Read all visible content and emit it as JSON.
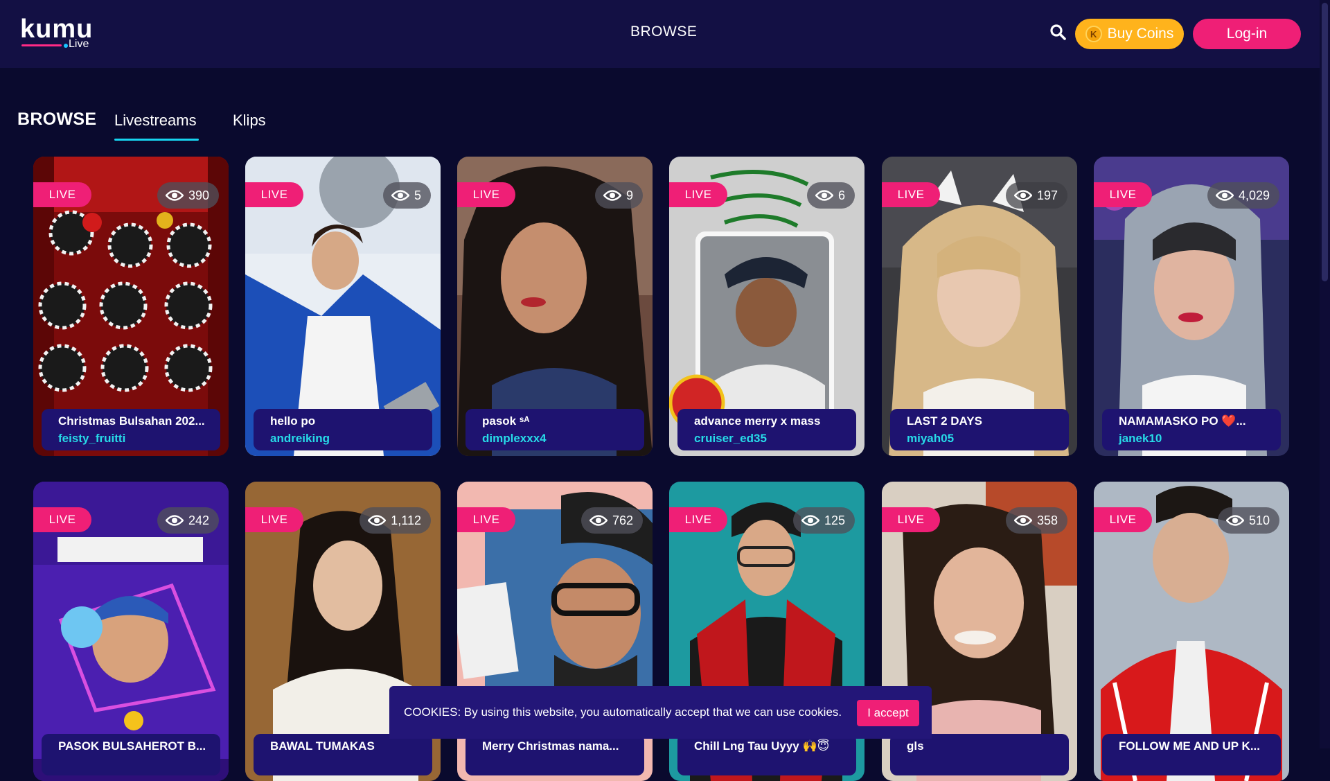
{
  "header": {
    "logo_word": "kumu",
    "logo_sub": "Live",
    "nav_center": "BROWSE",
    "buy_coins_label": "Buy Coins",
    "coin_letter": "K",
    "login_label": "Log-in"
  },
  "browse": {
    "title": "BROWSE",
    "tabs": [
      {
        "label": "Livestreams",
        "active": true
      },
      {
        "label": "Klips",
        "active": false
      }
    ]
  },
  "live_label": "LIVE",
  "streams": [
    {
      "title": "Christmas Bulsahan 202...",
      "user": "feisty_fruitti",
      "viewers": "390"
    },
    {
      "title": "hello po",
      "user": "andreiking",
      "viewers": "5"
    },
    {
      "title": "pasok ˢᴬ",
      "user": "dimplexxx4",
      "viewers": "9"
    },
    {
      "title": "advance merry x mass",
      "user": "cruiser_ed35",
      "viewers": "6"
    },
    {
      "title": "LAST 2 DAYS",
      "user": "miyah05",
      "viewers": "197"
    },
    {
      "title": "NAMAMASKO PO ❤️...",
      "user": "janek10",
      "viewers": "4,029"
    },
    {
      "title": "PASOK BULSAHEROT B...",
      "user": "",
      "viewers": "242"
    },
    {
      "title": "BAWAL TUMAKAS",
      "user": "",
      "viewers": "1,112"
    },
    {
      "title": "Merry Christmas nama...",
      "user": "",
      "viewers": "762"
    },
    {
      "title": "Chill Lng Tau Uyyy 🙌😇",
      "user": "",
      "viewers": "125"
    },
    {
      "title": "gls",
      "user": "",
      "viewers": "358"
    },
    {
      "title": "FOLLOW ME AND UP K...",
      "user": "",
      "viewers": "510"
    }
  ],
  "cookie": {
    "text": "COOKIES: By using this website, you automatically accept that we can use cookies.",
    "accept_label": "I accept"
  },
  "colors": {
    "header_bg": "#131044",
    "page_bg": "#0a0a2e",
    "accent_pink": "#ef1f76",
    "accent_cyan": "#27dbe8",
    "buy_coins_yellow": "#ffb31c"
  }
}
